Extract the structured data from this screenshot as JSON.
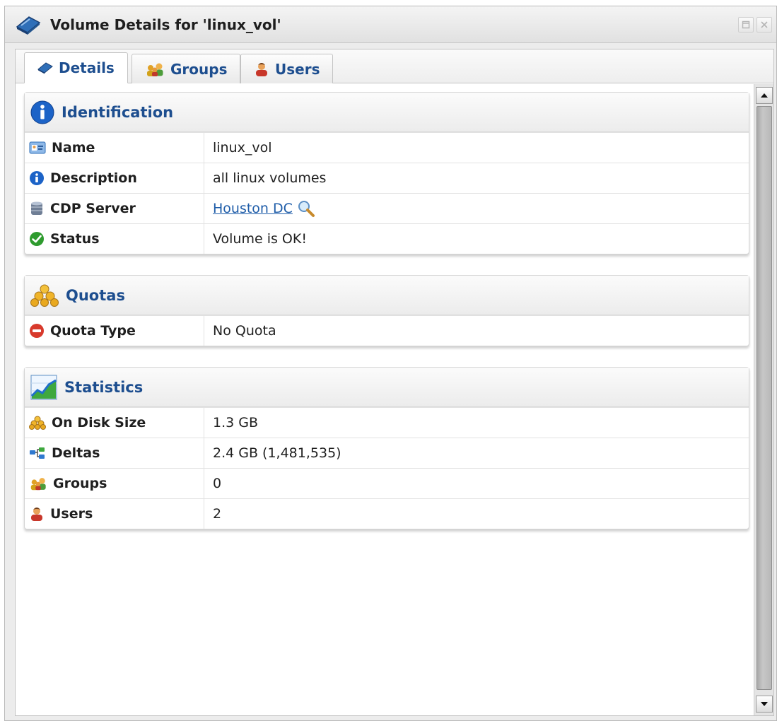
{
  "window": {
    "title": "Volume Details for 'linux_vol'"
  },
  "tabs": [
    {
      "label": "Details",
      "icon": "volume-icon",
      "active": true
    },
    {
      "label": "Groups",
      "icon": "groups-icon",
      "active": false
    },
    {
      "label": "Users",
      "icon": "user-icon",
      "active": false
    }
  ],
  "identification": {
    "title": "Identification",
    "rows": {
      "name": {
        "label": "Name",
        "value": "linux_vol"
      },
      "description": {
        "label": "Description",
        "value": "all linux volumes"
      },
      "cdp_server": {
        "label": "CDP Server",
        "value": "Houston DC"
      },
      "status": {
        "label": "Status",
        "value": "Volume is OK!"
      }
    }
  },
  "quotas": {
    "title": "Quotas",
    "rows": {
      "quota_type": {
        "label": "Quota Type",
        "value": "No Quota"
      }
    }
  },
  "statistics": {
    "title": "Statistics",
    "rows": {
      "on_disk_size": {
        "label": "On Disk Size",
        "value": "1.3 GB"
      },
      "deltas": {
        "label": "Deltas",
        "value": "2.4 GB (1,481,535)"
      },
      "groups": {
        "label": "Groups",
        "value": "0"
      },
      "users": {
        "label": "Users",
        "value": "2"
      }
    }
  },
  "colors": {
    "accent": "#1d4e8f",
    "link": "#1f5da9",
    "ok": "#2e9b2e",
    "error": "#d83a2c"
  }
}
